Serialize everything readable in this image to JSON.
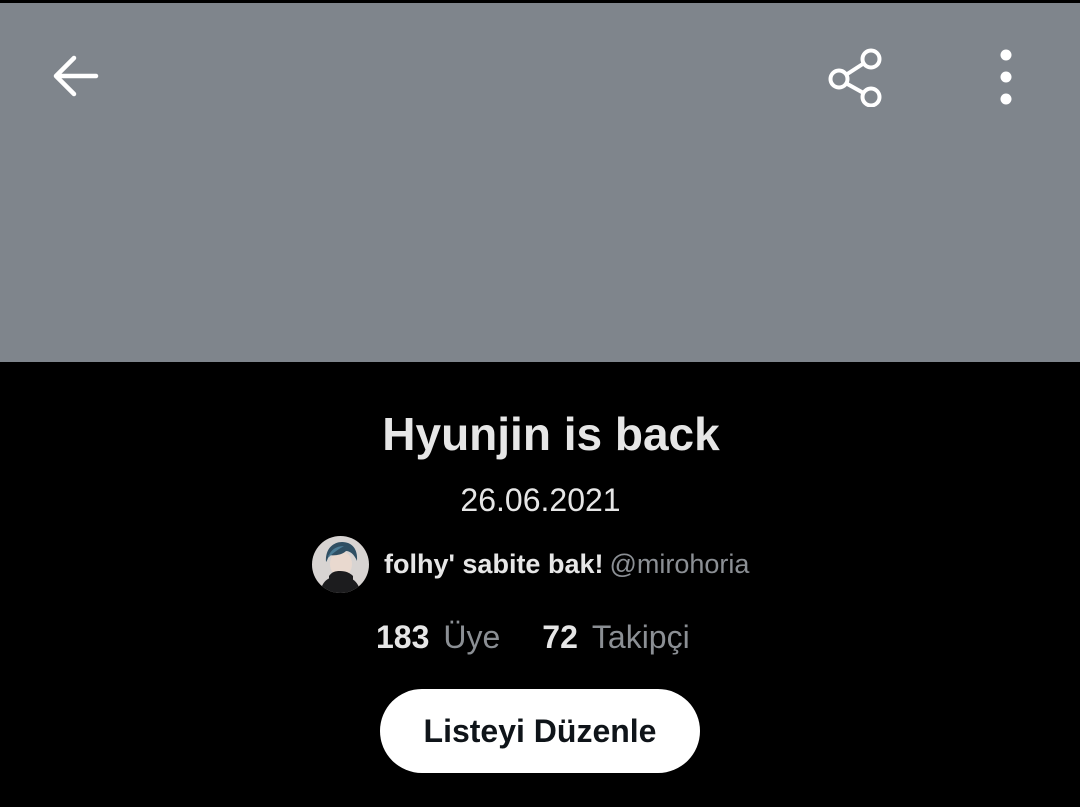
{
  "header": {
    "back_icon": "arrow-left-icon",
    "share_icon": "share-icon",
    "more_icon": "more-vertical-icon",
    "banner_color": "#7f858c"
  },
  "list": {
    "title": "Hyunjin is back",
    "description": "26.06.2021"
  },
  "owner": {
    "display_name": "folhy' sabite bak!",
    "handle": "@mirohoria"
  },
  "stats": {
    "members_count": "183",
    "members_label": "Üye",
    "followers_count": "72",
    "followers_label": "Takipçi"
  },
  "actions": {
    "edit_label": "Listeyi Düzenle"
  }
}
